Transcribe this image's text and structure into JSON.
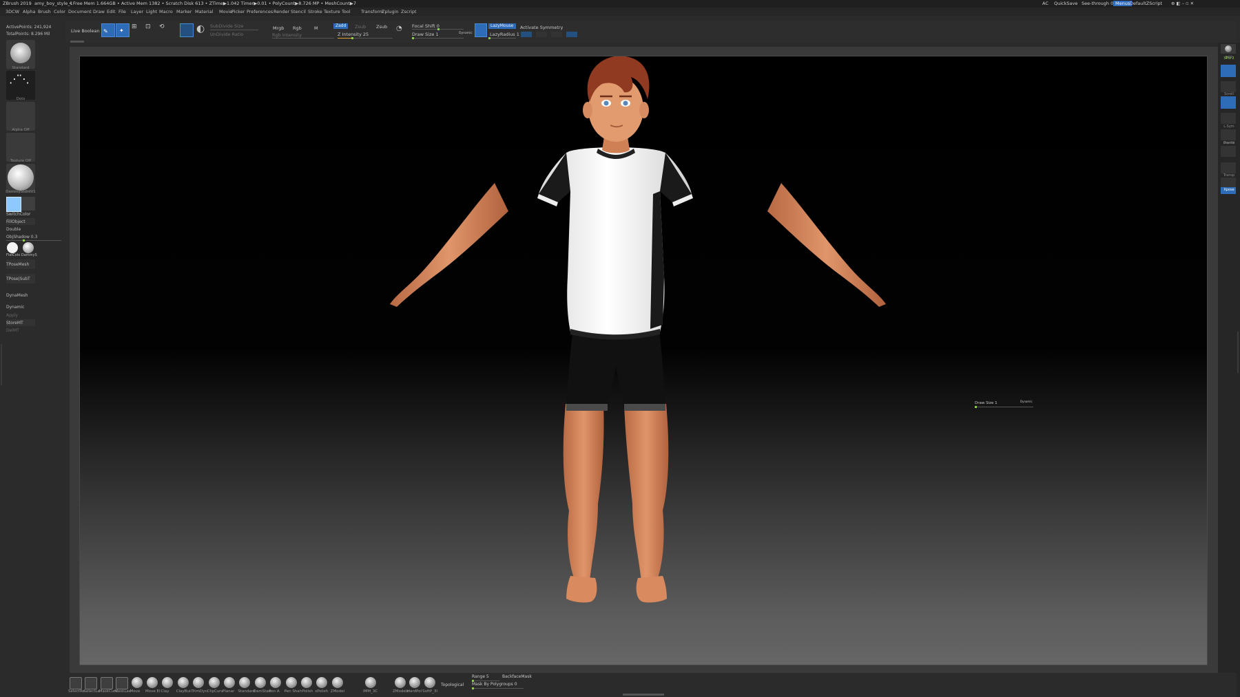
{
  "titlebar": {
    "app": "ZBrush 2019",
    "doc": "amy_boy_style_1",
    "stats": "• Free Mem 1.664GB • Active Mem 1382 • Scratch Disk 613 • ZTime▶1.042 Timer▶0.01 • PolyCount▶8.726 MP • MeshCount▶7",
    "ac": "AC",
    "quicksave": "QuickSave",
    "see_through": "See-through 0",
    "menus_btn": "Menus",
    "zscript": "DefaultZScript"
  },
  "menubar": [
    "3DCW",
    "Alpha",
    "Brush",
    "Color",
    "Document",
    "Draw",
    "Edit",
    "File",
    "Layer",
    "Light",
    "Macro",
    "Marker",
    "Material",
    "Movie",
    "Picker",
    "Preferences",
    "Render",
    "Stencil",
    "Stroke",
    "Texture",
    "Tool",
    "Transform",
    "Zplugin",
    "Zscript"
  ],
  "topshelf": {
    "live_boolean": "Live Boolean",
    "mode_buttons": [
      "Edit",
      "Draw",
      "Move",
      "Scale",
      "Rotate"
    ],
    "subdivide_size": "SubDivide Size",
    "undivide_ratio": "UnDivide Ratio",
    "mrgb": "Mrgb",
    "rgb": "Rgb",
    "m": "M",
    "rgb_intensity": "Rgb Intensity",
    "zadd": "Zadd",
    "zsub_dim": "Zsub",
    "zsub": "Zsub",
    "z_intensity": "Z Intensity 25",
    "focal_shift": "Focal Shift 0",
    "draw_size": "Draw Size 1",
    "dynamic": "Dynamic",
    "lazymouse": "LazyMouse",
    "lazyradius": "LazyRadius 1",
    "activate_symmetry": "Activate Symmetry"
  },
  "leftshelf": {
    "active_points": "ActivePoints: 241,924",
    "total_points": "TotalPoints: 8.296 Mil",
    "tiles": [
      "Standard",
      "Dots",
      "Alpha Off",
      "Texture Off",
      "DammyStdrdV1"
    ],
    "switch_color": "SwitchColor",
    "fill_object": "FillObject",
    "double": "Double",
    "obj_shadow": "ObjShadow 0.3",
    "mat_labels": "FlatColo DammyS",
    "tpose_mesh": "TPoseMesh",
    "tpose_subt": "TPose|SubT",
    "dynamesh": "DynaMesh",
    "dynamic": "Dynamic",
    "apply": "Apply",
    "store_mt": "StoreMT",
    "del_mt": "DelMT"
  },
  "viewport": {
    "draw_size": "Draw Size 1",
    "dynamic": "Dynamic"
  },
  "rightshelf": {
    "spix": "SPix 3",
    "labels": [
      "BPR",
      "",
      "Scroll",
      "Zoom",
      "Actual",
      "L.Sym",
      "Frame",
      "Line Fill",
      "Transp",
      "Solo",
      "Xpose"
    ]
  },
  "bottomshelf": {
    "brushes": [
      "SelectRe",
      "SelectLa",
      "MaskCurv",
      "MaskLas",
      "Move",
      "Move El",
      "Clay",
      "ClayBuil",
      "TrimDyn",
      "ClipCurv",
      "Planar",
      "Standard",
      "DamStan",
      "Pen A",
      "Pen Sha",
      "hPolish",
      "sPolish",
      "ZModel"
    ],
    "imm": "IMM_3C",
    "zmodeler": "ZModele",
    "hardpolish": "HardPol",
    "softpolish": "SoftP_3I",
    "topological": "Topological",
    "range": "Range 5",
    "backface_mask": "BackfaceMask",
    "mask_by_polygroups": "Mask By Polygroups 0"
  },
  "colors": {
    "accent": "#2f6cb7",
    "slider_active": "#8bd13b",
    "panel": "#2b2b2b"
  }
}
